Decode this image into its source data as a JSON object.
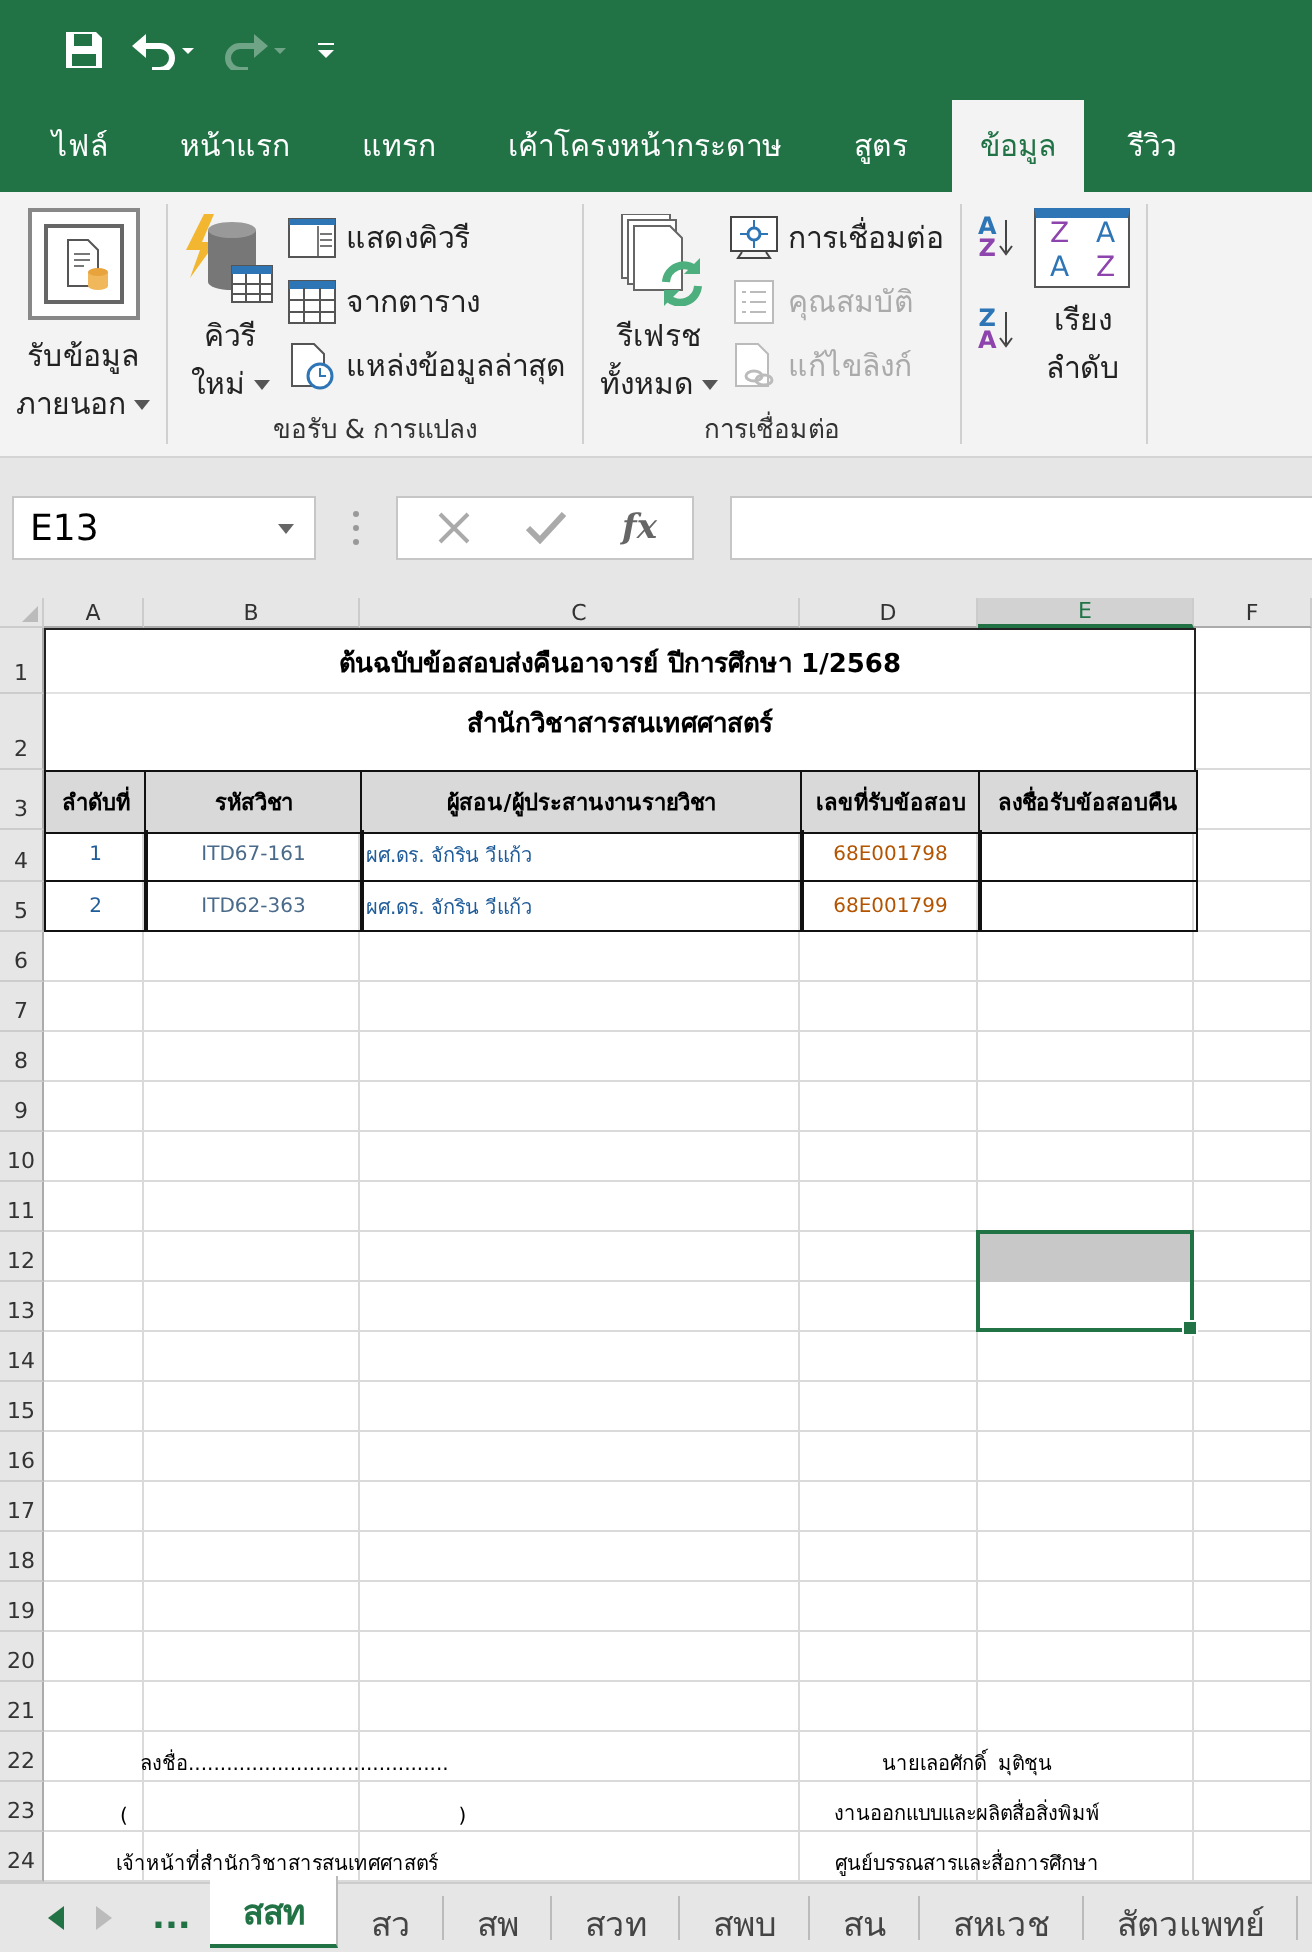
{
  "quick_access": [
    {
      "kind": "save",
      "disabled": false
    },
    {
      "kind": "undo",
      "disabled": false
    },
    {
      "kind": "redo",
      "disabled": true
    },
    {
      "kind": "customize",
      "disabled": false
    }
  ],
  "ribbon_tabs": [
    {
      "label": "ไฟล์",
      "selected": false
    },
    {
      "label": "หน้าแรก",
      "selected": false
    },
    {
      "label": "แทรก",
      "selected": false
    },
    {
      "label": "เค้าโครงหน้ากระดาษ",
      "selected": false
    },
    {
      "label": "สูตร",
      "selected": false
    },
    {
      "label": "ข้อมูล",
      "selected": true
    },
    {
      "label": "รีวิว",
      "selected": false
    }
  ],
  "ribbon_groups": [
    {
      "buttons": [
        {
          "kind": "large",
          "lines": [
            "รับข้อมูล",
            "ภายนอก"
          ],
          "dropdown": true,
          "framed": true
        }
      ]
    },
    {
      "label": "ขอรับ & การแปลง",
      "buttons": [
        {
          "kind": "large",
          "lines": [
            "คิวรี",
            "ใหม่"
          ],
          "dropdown": true
        },
        {
          "kind": "small",
          "label": "แสดงคิวรี",
          "disabled": false
        },
        {
          "kind": "small",
          "label": "จากตาราง",
          "disabled": false
        },
        {
          "kind": "small",
          "label": "แหล่งข้อมูลล่าสุด",
          "disabled": false
        }
      ]
    },
    {
      "label": "การเชื่อมต่อ",
      "buttons": [
        {
          "kind": "large",
          "lines": [
            "รีเฟรช",
            "ทั้งหมด"
          ],
          "dropdown": true
        },
        {
          "kind": "small",
          "label": "การเชื่อมต่อ",
          "disabled": false
        },
        {
          "kind": "small",
          "label": "คุณสมบัติ",
          "disabled": true
        },
        {
          "kind": "small",
          "label": "แก้ไขลิงก์",
          "disabled": true
        }
      ]
    },
    {
      "buttons": [
        {
          "kind": "sort",
          "letters": [
            "A",
            "Z"
          ]
        },
        {
          "kind": "sort",
          "letters": [
            "Z",
            "A"
          ]
        },
        {
          "kind": "sortbox",
          "letters": [
            "Z",
            "A",
            "A",
            "Z"
          ],
          "lines": [
            "เรียง",
            "ลำดับ"
          ]
        }
      ]
    }
  ],
  "name_box": "E13",
  "formula_buttons": [
    {
      "kind": "cancel"
    },
    {
      "kind": "enter"
    },
    {
      "kind": "function",
      "label": "fx"
    }
  ],
  "columns": [
    {
      "label": "A",
      "selected": false
    },
    {
      "label": "B",
      "selected": false
    },
    {
      "label": "C",
      "selected": false
    },
    {
      "label": "D",
      "selected": false
    },
    {
      "label": "E",
      "selected": true
    },
    {
      "label": "F",
      "selected": false
    }
  ],
  "rows": [
    "1",
    "2",
    "3",
    "4",
    "5",
    "6",
    "7",
    "8",
    "9",
    "10",
    "11",
    "12",
    "13",
    "14",
    "15",
    "16",
    "17",
    "18",
    "19",
    "20",
    "21",
    "22",
    "23",
    "24"
  ],
  "sheet": {
    "title": "ต้นฉบับข้อสอบส่งคืนอาจารย์ ปีการศึกษา 1/2568",
    "subtitle": "สำนักวิชาสารสนเทศศาสตร์",
    "table": {
      "headers": [
        "ลำดับที่",
        "รหัสวิชา",
        "ผู้สอน/ผู้ประสานงานรายวิชา",
        "เลขที่รับข้อสอบ",
        "ลงชื่อรับข้อสอบคืน"
      ],
      "rows": [
        [
          "1",
          "ITD67-161",
          "ผศ.ดร. จักริน วีแก้ว",
          "68E001798"
        ],
        [
          "2",
          "ITD62-363",
          "ผศ.ดร. จักริน วีแก้ว",
          "68E001799"
        ]
      ]
    },
    "signature_left": [
      "ลงชื่อ.........................................",
      "(                                                    )",
      "เจ้าหน้าที่สำนักวิชาสารสนเทศศาสตร์"
    ],
    "signature_right": [
      "นายเลอศักดิ์  มุติชุน",
      "งานออกแบบและผลิตสื่อสิ่งพิมพ์",
      "ศูนย์บรรณสารและสื่อการศึกษา"
    ]
  },
  "sheet_tabs": [
    {
      "label": "...",
      "selected": false
    },
    {
      "label": "สสท",
      "selected": true
    },
    {
      "label": "สว",
      "selected": false
    },
    {
      "label": "สพ",
      "selected": false
    },
    {
      "label": "สวท",
      "selected": false
    },
    {
      "label": "สพบ",
      "selected": false
    },
    {
      "label": "สน",
      "selected": false
    },
    {
      "label": "สหเวช",
      "selected": false
    },
    {
      "label": "สัตวแพทย์",
      "selected": false
    }
  ]
}
